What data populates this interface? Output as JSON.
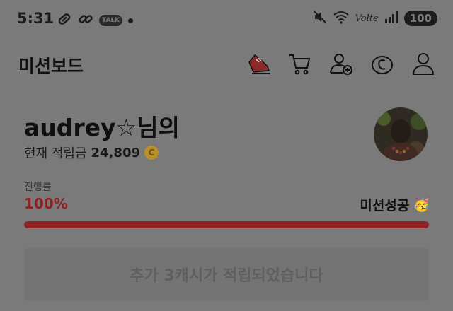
{
  "status_bar": {
    "time": "5:31",
    "talk_badge": "TALK",
    "network_label": "Volte",
    "battery": "100"
  },
  "header": {
    "title": "미션보드",
    "icons": [
      "sneaker-icon",
      "cart-icon",
      "add-user-icon",
      "coin-c-icon",
      "profile-icon"
    ]
  },
  "profile": {
    "greeting": "audrey☆님의",
    "points_label": "현재 적립금",
    "points_value": "24,809",
    "coin_symbol": "C"
  },
  "progress": {
    "label": "진행률",
    "percent_text": "100%",
    "fraction": 1.0,
    "status": "미션성공",
    "status_emoji": "🥳"
  },
  "banner": {
    "text": "추가 3캐시가 적립되었습니다"
  },
  "colors": {
    "overlay_bg": "#7a7a7a",
    "progress_red": "#8f2323",
    "coin_gold": "#b8912a"
  }
}
